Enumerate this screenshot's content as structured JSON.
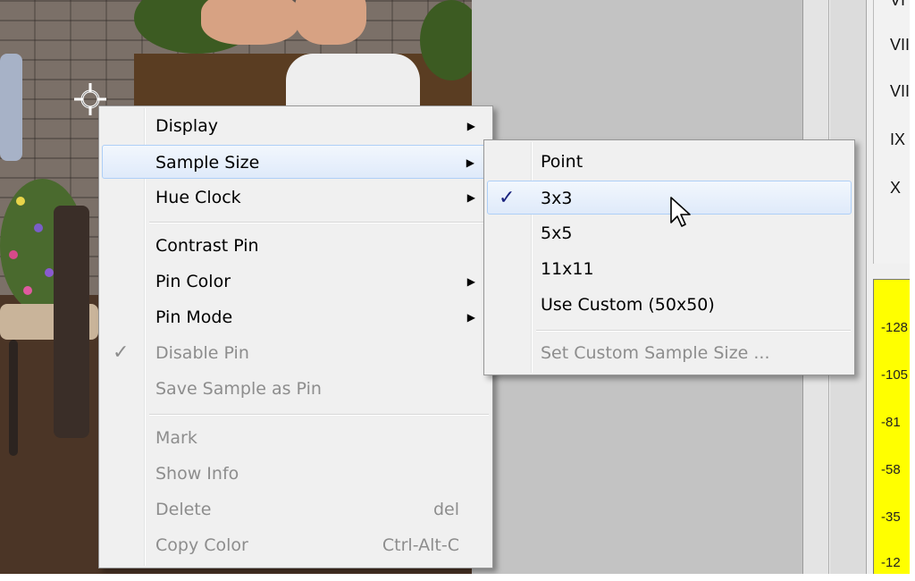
{
  "right_panel": {
    "roman_labels": [
      "VI",
      "VII",
      "VIII",
      "IX",
      "X"
    ],
    "y_ticks": [
      "-128",
      "-105",
      "-81",
      "-58",
      "-35",
      "-12"
    ]
  },
  "context_menu": {
    "items": [
      {
        "label": "Display",
        "submenu": true,
        "enabled": true
      },
      {
        "label": "Sample Size",
        "submenu": true,
        "enabled": true,
        "highlighted": true
      },
      {
        "label": "Hue Clock",
        "submenu": true,
        "enabled": true
      },
      {
        "label": "Contrast Pin",
        "enabled": true
      },
      {
        "label": "Pin Color",
        "submenu": true,
        "enabled": true
      },
      {
        "label": "Pin Mode",
        "submenu": true,
        "enabled": true
      },
      {
        "label": "Disable Pin",
        "enabled": false,
        "checked": true
      },
      {
        "label": "Save Sample as Pin",
        "enabled": false
      },
      {
        "label": "Mark",
        "enabled": false
      },
      {
        "label": "Show Info",
        "enabled": false
      },
      {
        "label": "Delete",
        "shortcut": "del",
        "enabled": false
      },
      {
        "label": "Copy Color",
        "shortcut": "Ctrl-Alt-C",
        "enabled": false
      }
    ],
    "check_glyph": "✓",
    "arrow_glyph": "▶"
  },
  "sample_size_submenu": {
    "items": [
      {
        "label": "Point"
      },
      {
        "label": "3x3",
        "checked": true,
        "highlighted": true
      },
      {
        "label": "5x5"
      },
      {
        "label": "11x11"
      },
      {
        "label": "Use Custom (50x50)"
      },
      {
        "label": "Set Custom Sample Size ...",
        "enabled": false
      }
    ]
  },
  "colors": {
    "menu_bg": "#f0f0f0",
    "highlight_border": "#aecff7",
    "disabled_text": "#8d8d8d",
    "yellow_panel": "#ffff00"
  },
  "icons": {
    "target": "crosshair-target-icon",
    "cursor": "mouse-pointer-icon"
  }
}
